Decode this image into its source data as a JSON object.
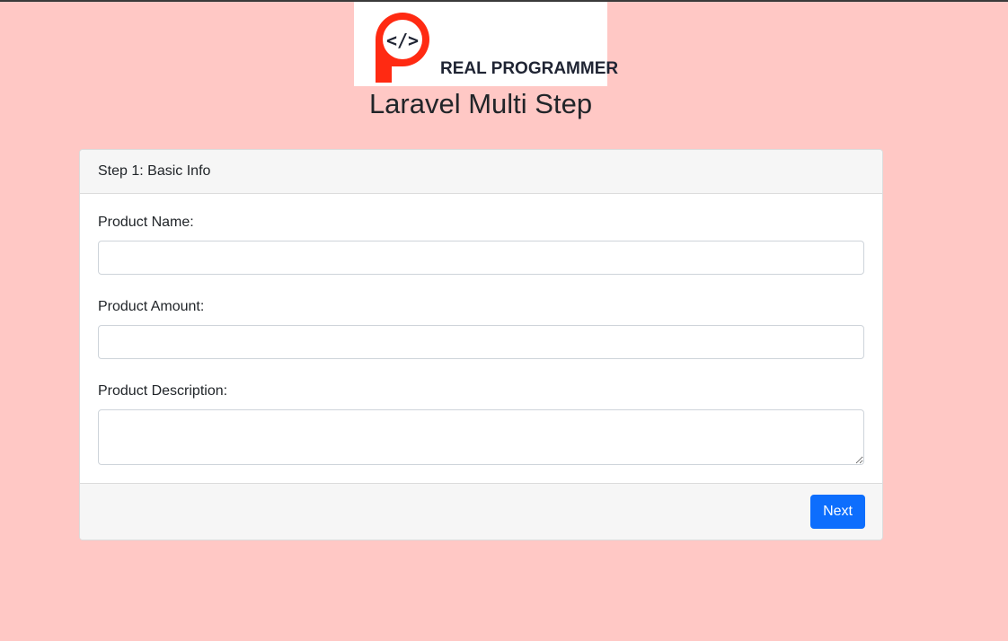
{
  "logo": {
    "brand_text": "REAL PROGRAMMER",
    "icon": "code-brackets-icon",
    "colors": {
      "mark": "#ff2a12",
      "text": "#1f2433"
    }
  },
  "page": {
    "title": "Laravel Multi Step",
    "background": "#ffc8c5"
  },
  "form": {
    "step_title": "Step 1: Basic Info",
    "fields": [
      {
        "label": "Product Name:",
        "value": "",
        "placeholder": ""
      },
      {
        "label": "Product Amount:",
        "value": "",
        "placeholder": ""
      },
      {
        "label": "Product Description:",
        "value": "",
        "placeholder": ""
      }
    ],
    "next_label": "Next",
    "accent": "#0d6efd"
  }
}
